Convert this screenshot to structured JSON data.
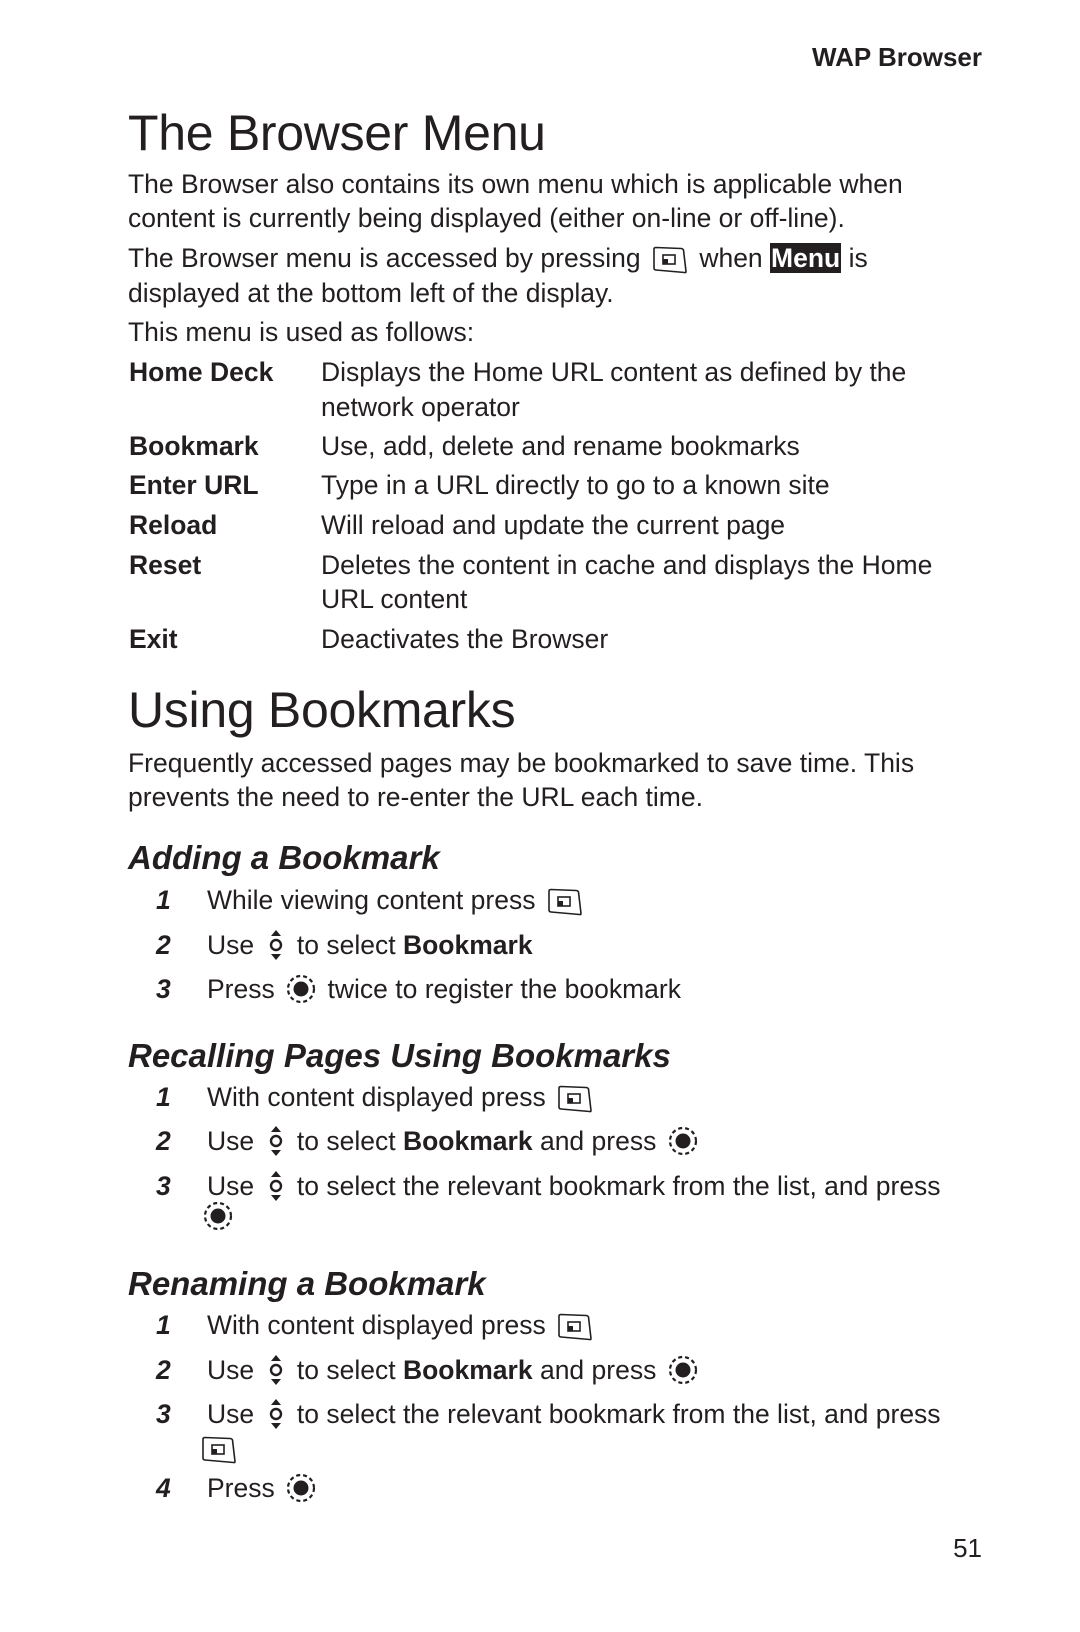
{
  "header": {
    "section": "WAP Browser"
  },
  "browser_menu": {
    "title": "The Browser Menu",
    "intro_line1": "The Browser also contains its own menu which is applicable when",
    "intro_line2": "content is currently being displayed (either on-line or off-line).",
    "access_pre": "The Browser menu is accessed by pressing",
    "access_when": "when",
    "menu_label": "Menu",
    "access_post": "is",
    "access_line2": "displayed at the bottom left of the display.",
    "usage": "This menu is used as follows:",
    "items": [
      {
        "term": "Home Deck",
        "desc1": "Displays the Home URL content as defined by the",
        "desc2": "network operator"
      },
      {
        "term": "Bookmark",
        "desc1": "Use, add, delete and rename bookmarks"
      },
      {
        "term": "Enter URL",
        "desc1": "Type in a URL directly to go to a known site"
      },
      {
        "term": "Reload",
        "desc1": "Will reload and update the current page"
      },
      {
        "term": "Reset",
        "desc1": "Deletes the content in cache and displays the Home",
        "desc2": "URL content"
      },
      {
        "term": "Exit",
        "desc1": "Deactivates the Browser"
      }
    ]
  },
  "using_bookmarks": {
    "title": "Using Bookmarks",
    "intro_line1": "Frequently accessed pages may be bookmarked to save time. This",
    "intro_line2": "prevents the need to re-enter the URL each time."
  },
  "adding": {
    "title": "Adding a Bookmark",
    "steps": [
      {
        "num": "1",
        "text": "While viewing content press"
      },
      {
        "num": "2",
        "pre": "Use",
        "mid": "to select",
        "bold": "Bookmark"
      },
      {
        "num": "3",
        "pre": "Press",
        "post": "twice to register the bookmark"
      }
    ]
  },
  "recalling": {
    "title": "Recalling Pages Using Bookmarks",
    "steps": [
      {
        "num": "1",
        "text": "With content displayed press"
      },
      {
        "num": "2",
        "pre": "Use",
        "mid": "to select",
        "bold": "Bookmark",
        "post": "and press"
      },
      {
        "num": "3",
        "pre": "Use",
        "post": "to select the relevant bookmark from the list, and press"
      }
    ]
  },
  "renaming": {
    "title": "Renaming a Bookmark",
    "steps": [
      {
        "num": "1",
        "text": "With content displayed press"
      },
      {
        "num": "2",
        "pre": "Use",
        "mid": "to select",
        "bold": "Bookmark",
        "post": "and press"
      },
      {
        "num": "3",
        "pre": "Use",
        "post": "to select the relevant bookmark from the list, and press"
      },
      {
        "num": "4",
        "pre": "Press"
      }
    ]
  },
  "icons": {
    "softkey": "left-softkey-icon",
    "navigate": "up-down-navigation-key-icon",
    "select": "select-center-key-icon"
  },
  "footer": {
    "page_number": "51"
  }
}
